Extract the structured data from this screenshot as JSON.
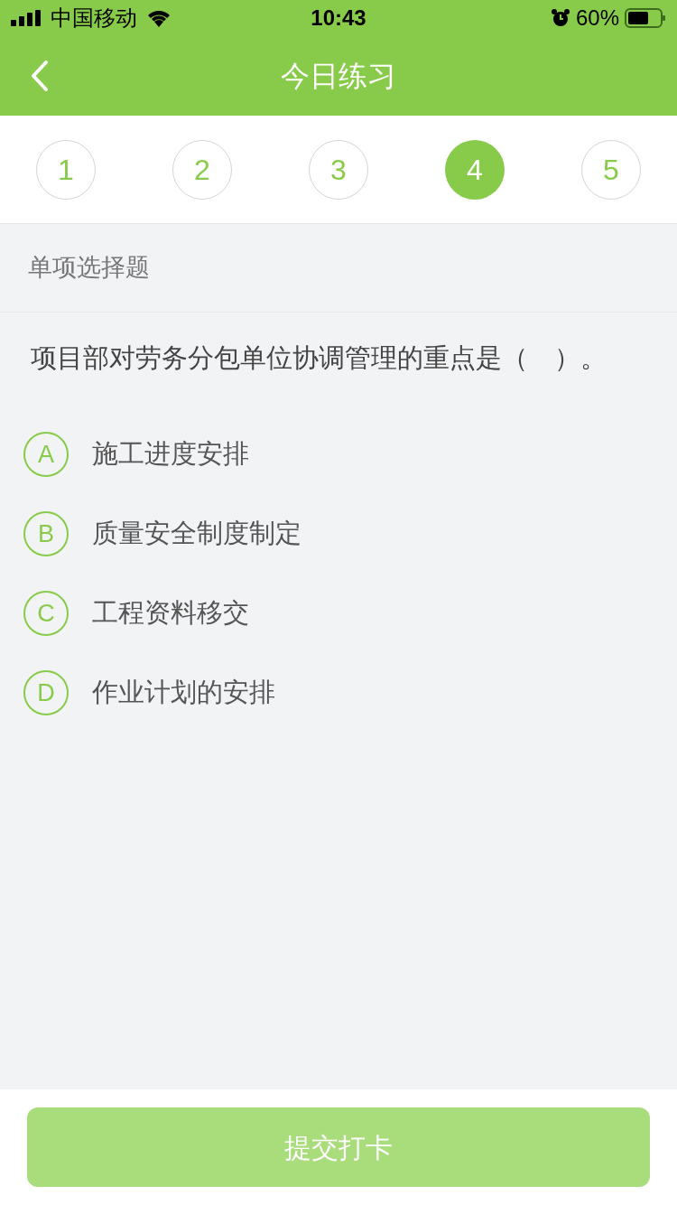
{
  "status_bar": {
    "carrier": "中国移动",
    "time": "10:43",
    "battery": "60%"
  },
  "nav": {
    "title": "今日练习"
  },
  "question_tabs": [
    {
      "label": "1",
      "selected": false
    },
    {
      "label": "2",
      "selected": false
    },
    {
      "label": "3",
      "selected": false
    },
    {
      "label": "4",
      "selected": true
    },
    {
      "label": "5",
      "selected": false
    }
  ],
  "section_title": "单项选择题",
  "question": "项目部对劳务分包单位协调管理的重点是（　）。",
  "options": [
    {
      "letter": "A",
      "text": "施工进度安排",
      "selected": false
    },
    {
      "letter": "B",
      "text": "质量安全制度制定",
      "selected": false
    },
    {
      "letter": "C",
      "text": "工程资料移交",
      "selected": false
    },
    {
      "letter": "D",
      "text": "作业计划的安排",
      "selected": false
    }
  ],
  "submit": {
    "label": "提交打卡",
    "disabled": true
  }
}
